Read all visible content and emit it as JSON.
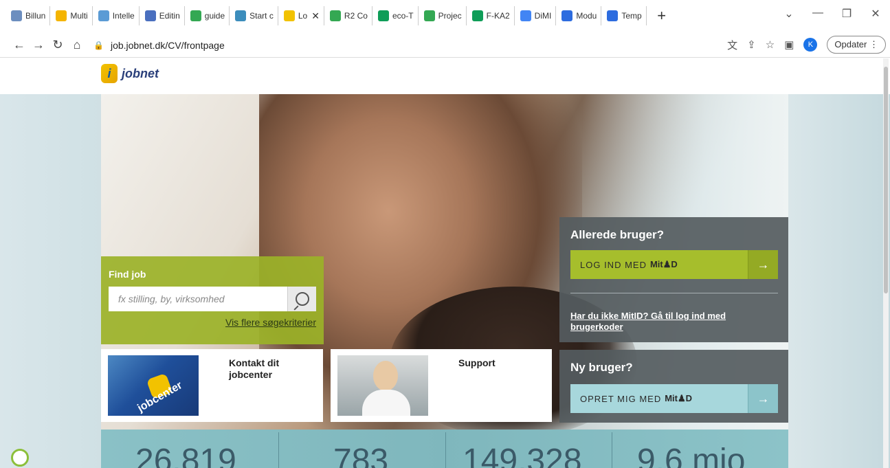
{
  "browser": {
    "tabs": [
      {
        "label": "Billun",
        "color": "#6c8ebf"
      },
      {
        "label": "Multi",
        "color": "#f4b400"
      },
      {
        "label": "Intelle",
        "color": "#5b9bd5"
      },
      {
        "label": "Editin",
        "color": "#4a6fbf"
      },
      {
        "label": "guide",
        "color": "#34a853"
      },
      {
        "label": "Start c",
        "color": "#3c8dbc"
      },
      {
        "label": "Lo",
        "color": "#f2c200",
        "active": true
      },
      {
        "label": "R2 Co",
        "color": "#34a853"
      },
      {
        "label": "eco-T",
        "color": "#0f9d58"
      },
      {
        "label": "Projec",
        "color": "#34a853"
      },
      {
        "label": "F-KA2",
        "color": "#0f9d58"
      },
      {
        "label": "DiMI",
        "color": "#4285f4"
      },
      {
        "label": "Modu",
        "color": "#2d6cdf"
      },
      {
        "label": "Temp",
        "color": "#2d6cdf"
      }
    ],
    "new_tab": "+",
    "url": "job.jobnet.dk/CV/frontpage",
    "profile_initial": "K",
    "update_label": "Opdater"
  },
  "site": {
    "logo_text": "jobnet",
    "logo_mark": "i"
  },
  "findjob": {
    "heading": "Find job",
    "placeholder": "fx stilling, by, virksomhed",
    "more_link": "Vis flere søgekriterier"
  },
  "cards": [
    {
      "title": "Kontakt dit jobcenter",
      "thumb_word": "jobcenter"
    },
    {
      "title": "Support"
    }
  ],
  "login": {
    "heading": "Allerede bruger?",
    "login_button": "LOG IND MED",
    "mitid_brand": "Mit♟D",
    "mitid_link": "Har du ikke MitID? Gå til log ind med brugerkoder"
  },
  "newuser": {
    "heading": "Ny bruger?",
    "create_button": "OPRET MIG MED",
    "mitid_brand": "Mit♟D"
  },
  "stats": [
    "26.819",
    "783",
    "149.328",
    "9,6 mio"
  ]
}
